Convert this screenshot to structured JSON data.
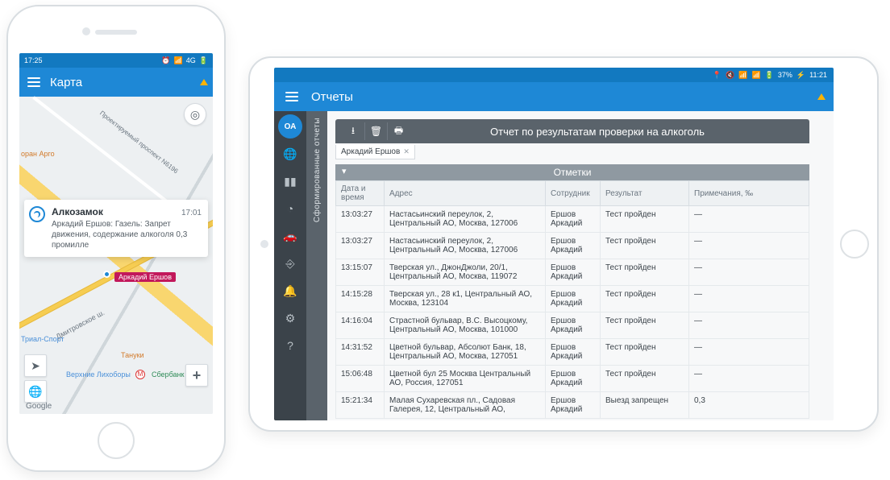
{
  "phone": {
    "statusbar": {
      "time": "17:25",
      "network": "4G",
      "battery": "85"
    },
    "appbar": {
      "title": "Карта"
    },
    "map": {
      "pin_label": "Аркадий Ершов",
      "poi_argo": "оран Арго",
      "poi_prospekt": "Проектируемый проспект N6196",
      "poi_dmitr": "Дмитровское ш.",
      "poi_trial": "Триал-Спорт",
      "poi_tanuki": "Тануки",
      "poi_likhobory": "Верхние Лихоборы",
      "poi_sber": "Сбербанк",
      "google": "Google"
    },
    "notification": {
      "title": "Алкозамок",
      "time": "17:01",
      "body": "Аркадий Ершов: Газель: Запрет движения, содержание алкоголя 0,3 промилле"
    }
  },
  "tablet": {
    "statusbar": {
      "battery": "37%",
      "time": "11:21"
    },
    "appbar": {
      "title": "Отчеты"
    },
    "sidebar": {
      "active_badge": "ОА",
      "icons": [
        "globe-icon",
        "chart-icon",
        "clock-icon",
        "car-icon",
        "logout-icon",
        "bell-icon",
        "gear-icon",
        "help-icon"
      ]
    },
    "vtab": {
      "label": "Сформированные отчеты"
    },
    "report": {
      "title": "Отчет по результатам проверки на алкоголь",
      "chip": "Аркадий Ершов",
      "section": "Отметки",
      "columns": {
        "time": "Дата и время",
        "address": "Адрес",
        "employee": "Сотрудник",
        "result": "Результат",
        "notes": "Примечания, ‰"
      },
      "rows": [
        {
          "time": "13:03:27",
          "address": "Настасьинский переулок, 2, Центральный АО, Москва, 127006",
          "employee": "Ершов Аркадий",
          "result": "Тест пройден",
          "notes": "—"
        },
        {
          "time": "13:03:27",
          "address": "Настасьинский переулок, 2, Центральный АО, Москва, 127006",
          "employee": "Ершов Аркадий",
          "result": "Тест пройден",
          "notes": "—"
        },
        {
          "time": "13:15:07",
          "address": "Тверская ул., ДжонДжоли, 20/1, Центральный АО, Москва, 119072",
          "employee": "Ершов Аркадий",
          "result": "Тест пройден",
          "notes": "—"
        },
        {
          "time": "14:15:28",
          "address": "Тверская ул., 28 к1, Центральный АО, Москва, 123104",
          "employee": "Ершов Аркадий",
          "result": "Тест пройден",
          "notes": "—"
        },
        {
          "time": "14:16:04",
          "address": "Страстной бульвар, В.С. Высоцкому, Центральный АО, Москва, 101000",
          "employee": "Ершов Аркадий",
          "result": "Тест пройден",
          "notes": "—"
        },
        {
          "time": "14:31:52",
          "address": "Цветной бульвар, Абсолют Банк, 18, Центральный АО, Москва, 127051",
          "employee": "Ершов Аркадий",
          "result": "Тест пройден",
          "notes": "—"
        },
        {
          "time": "15:06:48",
          "address": "Цветной бул 25 Москва Центральный АО, Россия, 127051",
          "employee": "Ершов Аркадий",
          "result": "Тест пройден",
          "notes": "—"
        },
        {
          "time": "15:21:34",
          "address": "Малая Сухаревская пл., Садовая Галерея, 12, Центральный АО,",
          "employee": "Ершов Аркадий",
          "result": "Выезд запрещен",
          "notes": "0,3"
        }
      ]
    }
  }
}
